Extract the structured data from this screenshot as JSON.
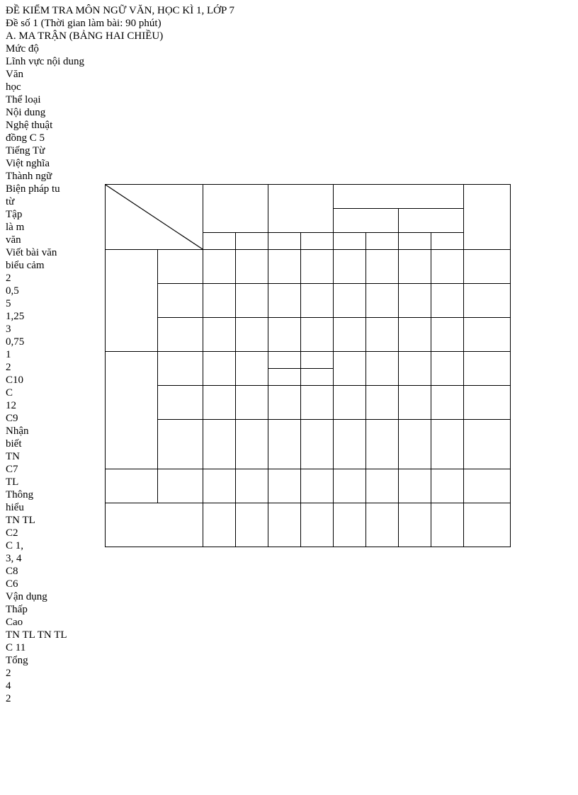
{
  "doc": {
    "title": "ĐỀ KIỂM TRA MÔN NGỮ VĂN, HỌC KÌ 1, LỚP 7",
    "subtitle": "Đề số 1 (Thời gian làm bài: 90 phút)",
    "section_a": "A. MA TRẬN (BẢNG HAI CHIỀU)",
    "lines": [
      "Mức độ",
      "Lĩnh vực nội dung",
      "Văn",
      "học",
      "Thể loại",
      "Nội dung",
      "Nghệ thuật",
      "đồng C 5",
      "Tiếng Từ",
      "Việt nghĩa",
      "Thành ngữ",
      "Biện pháp tu",
      "từ",
      "Tập",
      "là m",
      "văn",
      "Viết bài văn",
      "biểu cảm",
      "2",
      "0,5",
      "5",
      "1,25",
      "3",
      "0,75",
      "1",
      "2",
      "C10",
      "C",
      "12",
      "C9",
      "Nhận",
      "biết",
      "TN",
      "C7",
      "TL",
      "Thông",
      "hiểu",
      "TN TL",
      "C2",
      "C 1,",
      "3, 4",
      "C8",
      "C6",
      "Vận dụng",
      "Thấp",
      "Cao",
      "TN TL TN TL",
      "C 11",
      "Tổng",
      "2",
      "4",
      "2"
    ]
  }
}
